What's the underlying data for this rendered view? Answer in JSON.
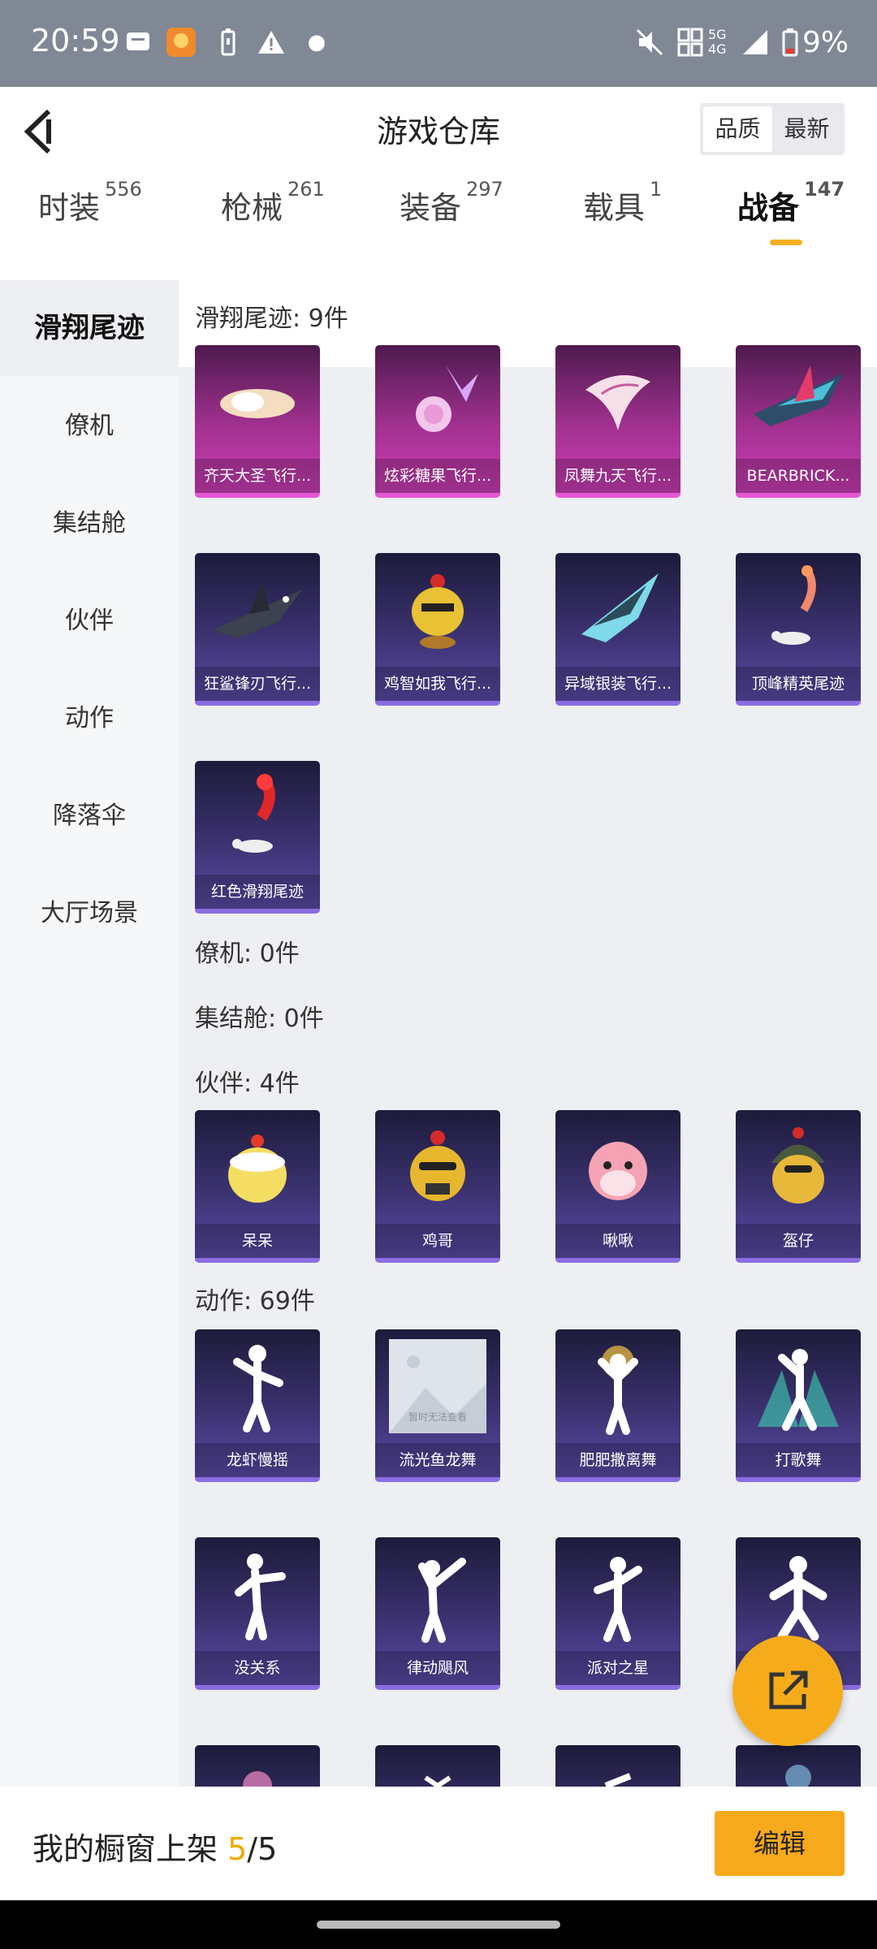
{
  "status": {
    "time": "20:59",
    "network": "5G 4G",
    "battery": "9%"
  },
  "header": {
    "title": "游戏仓库",
    "sort": [
      "品质",
      "最新"
    ]
  },
  "tabs": [
    {
      "label": "时装",
      "count": "556"
    },
    {
      "label": "枪械",
      "count": "261"
    },
    {
      "label": "装备",
      "count": "297"
    },
    {
      "label": "载具",
      "count": "1"
    },
    {
      "label": "战备",
      "count": "147"
    }
  ],
  "sidebar": [
    "滑翔尾迹",
    "僚机",
    "集结舱",
    "伙伴",
    "动作",
    "降落伞",
    "大厅场景"
  ],
  "sections": {
    "glide": {
      "heading": "滑翔尾迹: 9件",
      "items": [
        "齐天大圣飞行...",
        "炫彩糖果飞行...",
        "凤舞九天飞行...",
        "BEARBRICK...",
        "狂鲨锋刃飞行...",
        "鸡智如我飞行...",
        "异域银装飞行...",
        "顶峰精英尾迹",
        "红色滑翔尾迹"
      ]
    },
    "wingman": {
      "heading": "僚机: 0件"
    },
    "capsule": {
      "heading": "集结舱: 0件"
    },
    "partner": {
      "heading": "伙伴: 4件",
      "items": [
        "呆呆",
        "鸡哥",
        "啾啾",
        "盔仔"
      ]
    },
    "emote": {
      "heading": "动作: 69件",
      "items": [
        "龙虾慢摇",
        "流光鱼龙舞",
        "肥肥撒离舞",
        "打歌舞",
        "没关系",
        "律动飓风",
        "派对之星",
        ""
      ],
      "placeholder": "暂时无法查看"
    }
  },
  "bottom": {
    "prefix": "我的橱窗上架 ",
    "current": "5",
    "total": "/5",
    "edit": "编辑"
  },
  "colors": {
    "accent": "#f7a91c",
    "purple_rarity": "#cc3eb6",
    "blue_rarity": "#5a4aa6"
  }
}
